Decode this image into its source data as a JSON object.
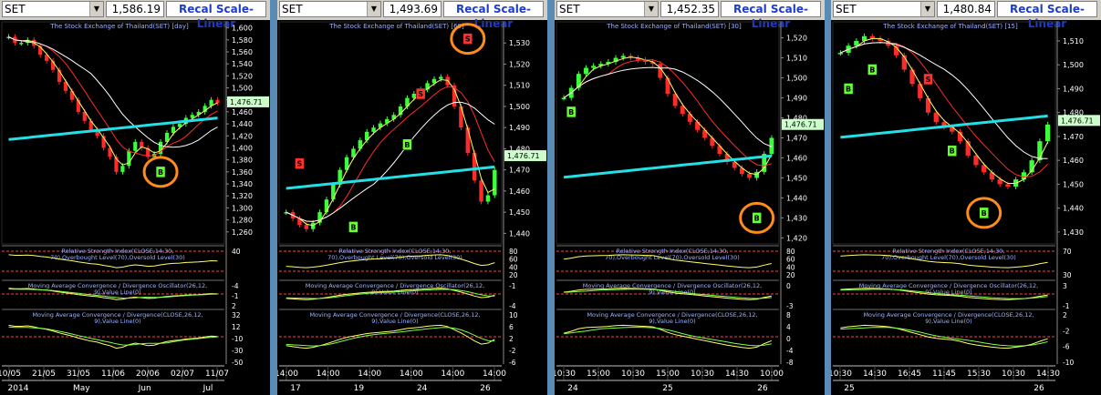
{
  "panels": [
    {
      "symbol": "SET",
      "price": "1,586.19",
      "recal": "Recal Scale-Linear",
      "title": "The Stock Exchange of Thailand(SET) [day]",
      "price_axis": {
        "min": 1240,
        "max": 1610,
        "ticks": [
          "1,600",
          "1,580",
          "1,560",
          "1,540",
          "1,520",
          "1,500",
          "1,480",
          "1,460",
          "1,440",
          "1,420",
          "1,400",
          "1,380",
          "1,360",
          "1,340",
          "1,320",
          "1,300",
          "1,280",
          "1,260"
        ]
      },
      "last_label": "1,476.71",
      "rsi_label": "Relative Strength Index(CLOSE,14,30,70),Overbought Level(70),Oversold Level(30)",
      "rsi_ticks": [
        "40"
      ],
      "osc_label": "Moving Average Convergence / Divergence Oscillator(26,12,9),Value Line(0)",
      "osc_ticks": [
        "-4",
        "-1",
        "2"
      ],
      "macd_label": "Moving Average Convergence / Divergence(CLOSE,26,12,9),Value Line(0)",
      "macd_ticks": [
        "32",
        "12",
        "-10",
        "-30",
        "-50"
      ],
      "time_labels": [
        "10/05",
        "21/05",
        "31/05",
        "11/06",
        "20/06",
        "02/07",
        "11/07"
      ],
      "period_labels": [
        "2014",
        "May",
        "Jun",
        "Jul"
      ]
    },
    {
      "symbol": "SET",
      "price": "1,493.69",
      "recal": "Recal Scale-Linear",
      "title": "The Stock Exchange of Thailand(SET) [60]",
      "price_axis": {
        "min": 1435,
        "max": 1540,
        "ticks": [
          "1,530",
          "1,520",
          "1,510",
          "1,500",
          "1,490",
          "1,480",
          "1,470",
          "1,460",
          "1,450",
          "1,440"
        ]
      },
      "last_label": "1,476.71",
      "rsi_label": "Relative Strength Index(CLOSE,14,30,70),Overbought Level(70),Oversold Level(30)",
      "rsi_ticks": [
        "80",
        "60",
        "40",
        "20"
      ],
      "osc_label": "Moving Average Convergence / Divergence Oscillator(26,12,9),Value Line(0)",
      "osc_ticks": [
        "-1",
        "-4"
      ],
      "macd_label": "Moving Average Convergence / Divergence(CLOSE,26,12,9),Value Line(0)",
      "macd_ticks": [
        "10",
        "6",
        "2",
        "-2",
        "-6"
      ],
      "time_labels": [
        "14:00",
        "14:00",
        "14:00",
        "14:00",
        "14:00",
        "14:00"
      ],
      "period_labels": [
        "17",
        "19",
        "24",
        "26"
      ]
    },
    {
      "symbol": "SET",
      "price": "1,452.35",
      "recal": "Recal Scale-Linear",
      "title": "The Stock Exchange of Thailand(SET) [30]",
      "price_axis": {
        "min": 1417,
        "max": 1528,
        "ticks": [
          "1,520",
          "1,510",
          "1,500",
          "1,490",
          "1,480",
          "1,470",
          "1,460",
          "1,450",
          "1,440",
          "1,430",
          "1,420"
        ]
      },
      "last_label": "1,476.71",
      "rsi_label": "Relative Strength Index(CLOSE,14,30,70),Overbought Level(70),Oversold Level(30)",
      "rsi_ticks": [
        "80",
        "60",
        "40",
        "20"
      ],
      "osc_label": "Moving Average Convergence / Divergence Oscillator(26,12,9),Value Line(0)",
      "osc_ticks": [
        "0",
        "-3"
      ],
      "macd_label": "Moving Average Convergence / Divergence(CLOSE,26,12,9),Value Line(0)",
      "macd_ticks": [
        "8",
        "4",
        "0",
        "-4",
        "-8"
      ],
      "time_labels": [
        "10:30",
        "15:00",
        "10:30",
        "15:00",
        "10:30",
        "14:30",
        "10:00"
      ],
      "period_labels": [
        "24",
        "25",
        "26"
      ]
    },
    {
      "symbol": "SET",
      "price": "1,480.84",
      "recal": "Recal Scale-Linear",
      "title": "The Stock Exchange of Thailand(SET) [15]",
      "price_axis": {
        "min": 1425,
        "max": 1518,
        "ticks": [
          "1,510",
          "1,500",
          "1,490",
          "1,480",
          "1,470",
          "1,460",
          "1,450",
          "1,440",
          "1,430"
        ]
      },
      "last_label": "1,476.71",
      "rsi_label": "Relative Strength Index(CLOSE,14,30,70),Overbought Level(70),Oversold Level(30)",
      "rsi_ticks": [
        "70",
        "30"
      ],
      "osc_label": "Moving Average Convergence / Divergence Oscillator(26,12,9),Value Line(0)",
      "osc_ticks": [
        "3",
        "-1"
      ],
      "macd_label": "Moving Average Convergence / Divergence(CLOSE,26,12,9),Value Line(0)",
      "macd_ticks": [
        "2",
        "-2",
        "-6",
        "-10"
      ],
      "time_labels": [
        "10:30",
        "14:30",
        "16:45",
        "11:45",
        "15:30",
        "10:30",
        "14:30"
      ],
      "period_labels": [
        "25",
        "26"
      ]
    }
  ],
  "chart_data": [
    {
      "type": "candlestick",
      "title": "The Stock Exchange of Thailand(SET) [day]",
      "close": [
        1585,
        1575,
        1575,
        1580,
        1570,
        1555,
        1545,
        1530,
        1510,
        1495,
        1480,
        1460,
        1445,
        1430,
        1420,
        1400,
        1385,
        1360,
        1370,
        1395,
        1410,
        1400,
        1385,
        1390,
        1410,
        1425,
        1435,
        1440,
        1450,
        1455,
        1460,
        1470,
        1480,
        1475
      ],
      "ma_fast": [
        1570,
        1565,
        1562,
        1560,
        1552,
        1540,
        1528,
        1512,
        1495,
        1478,
        1460,
        1440,
        1423,
        1410,
        1398,
        1390,
        1385,
        1388,
        1396,
        1404,
        1410,
        1415,
        1418,
        1425,
        1432,
        1440,
        1446,
        1452,
        1458,
        1462,
        1468,
        1475
      ],
      "ma_slow": [
        1560,
        1558,
        1555,
        1550,
        1540,
        1530,
        1518,
        1505,
        1490,
        1475,
        1460,
        1448,
        1440,
        1432,
        1424,
        1418,
        1415,
        1413,
        1415,
        1418,
        1422,
        1425,
        1428,
        1432,
        1438,
        1443,
        1448,
        1452,
        1458,
        1462
      ],
      "ma_long": [
        1400,
        1402,
        1404,
        1406,
        1408,
        1410,
        1412,
        1414,
        1416,
        1418,
        1420,
        1422,
        1424,
        1426,
        1428,
        1430,
        1432,
        1434,
        1436,
        1438
      ],
      "signals": [
        {
          "type": "B",
          "x": 24,
          "y": 1360
        }
      ],
      "y_range": [
        1240,
        1610
      ]
    },
    {
      "type": "candlestick",
      "title": "The Stock Exchange of Thailand(SET) [60]",
      "close": [
        1450,
        1447,
        1444,
        1442,
        1445,
        1450,
        1456,
        1463,
        1470,
        1476,
        1480,
        1484,
        1488,
        1490,
        1492,
        1494,
        1496,
        1500,
        1504,
        1506,
        1508,
        1511,
        1513,
        1514,
        1510,
        1500,
        1490,
        1478,
        1465,
        1455,
        1458,
        1470
      ],
      "signals": [
        {
          "type": "S",
          "x": 2,
          "y": 1473
        },
        {
          "type": "B",
          "x": 10,
          "y": 1443
        },
        {
          "type": "B",
          "x": 18,
          "y": 1482
        },
        {
          "type": "S",
          "x": 20,
          "y": 1506
        },
        {
          "type": "S",
          "x": 27,
          "y": 1532
        }
      ],
      "y_range": [
        1435,
        1540
      ]
    },
    {
      "type": "candlestick",
      "title": "The Stock Exchange of Thailand(SET) [30]",
      "close": [
        1490,
        1495,
        1502,
        1505,
        1506,
        1507,
        1508,
        1510,
        1511,
        1510,
        1509,
        1508,
        1507,
        1500,
        1492,
        1486,
        1482,
        1478,
        1474,
        1470,
        1466,
        1462,
        1458,
        1455,
        1452,
        1450,
        1453,
        1462,
        1470
      ],
      "signals": [
        {
          "type": "B",
          "x": 1,
          "y": 1483
        },
        {
          "type": "B",
          "x": 26,
          "y": 1430
        }
      ],
      "y_range": [
        1417,
        1528
      ]
    },
    {
      "type": "candlestick",
      "title": "The Stock Exchange of Thailand(SET) [15]",
      "close": [
        1505,
        1508,
        1510,
        1512,
        1511,
        1510,
        1508,
        1504,
        1498,
        1492,
        1486,
        1480,
        1476,
        1474,
        1472,
        1468,
        1462,
        1458,
        1455,
        1452,
        1450,
        1449,
        1452,
        1455,
        1460,
        1468,
        1475
      ],
      "signals": [
        {
          "type": "B",
          "x": 1,
          "y": 1490
        },
        {
          "type": "B",
          "x": 4,
          "y": 1498
        },
        {
          "type": "S",
          "x": 11,
          "y": 1494
        },
        {
          "type": "B",
          "x": 14,
          "y": 1464
        },
        {
          "type": "B",
          "x": 18,
          "y": 1438
        }
      ],
      "y_range": [
        1425,
        1518
      ]
    }
  ]
}
